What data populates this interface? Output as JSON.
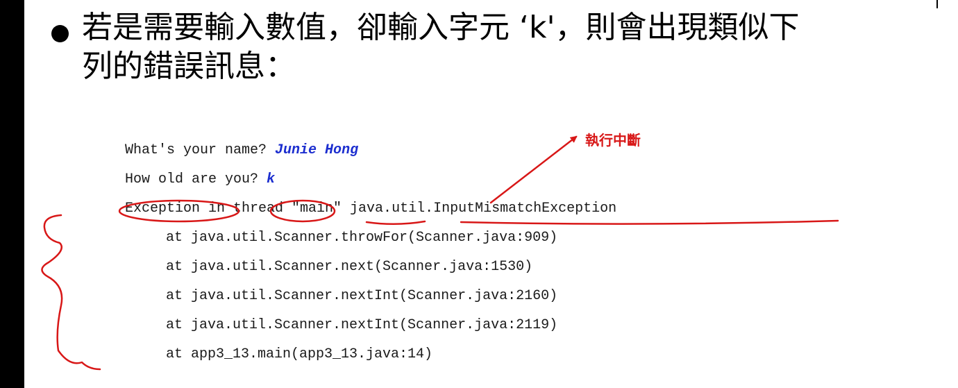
{
  "slide": {
    "bullet_text": "若是需要輸入數值，卻輸入字元  ‘k'，則會出現類似下\n列的錯誤訊息："
  },
  "console": {
    "prompt_name": "What's your name? ",
    "input_name": "Junie Hong",
    "prompt_age": "How old are you? ",
    "input_age": "k",
    "exception_line": "Exception in thread \"main\" java.util.InputMismatchException",
    "stack_trace": [
      "at java.util.Scanner.throwFor(Scanner.java:909)",
      "at java.util.Scanner.next(Scanner.java:1530)",
      "at java.util.Scanner.nextInt(Scanner.java:2160)",
      "at java.util.Scanner.nextInt(Scanner.java:2119)",
      "at app3_13.main(app3_13.java:14)"
    ]
  },
  "annotation": {
    "label": "執行中斷",
    "color": "#d81717"
  }
}
